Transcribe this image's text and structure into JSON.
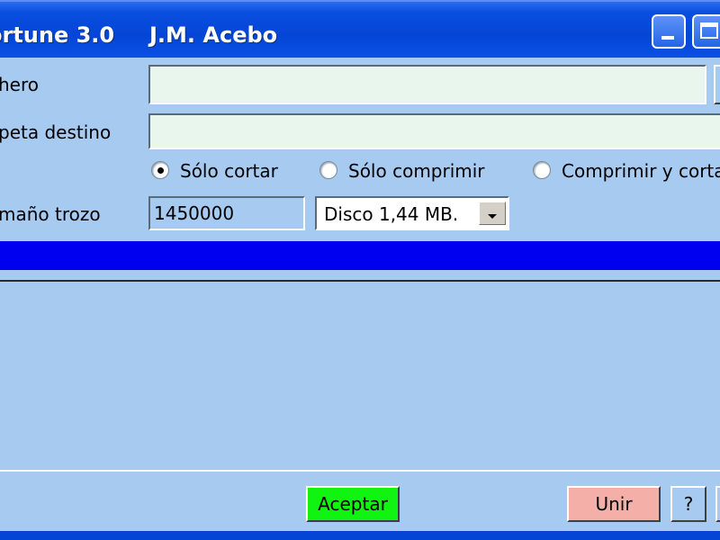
{
  "window": {
    "title": "ortune 3.0",
    "author": "J.M. Acebo"
  },
  "form": {
    "fichero_label": "hero",
    "fichero_value": "",
    "carpeta_label": "peta destino",
    "carpeta_value": "",
    "mode_options": [
      {
        "label": "Sólo cortar",
        "selected": true
      },
      {
        "label": "Sólo comprimir",
        "selected": false
      },
      {
        "label": "Comprimir y cortar",
        "selected": false
      }
    ],
    "tamano_label": "maño trozo",
    "tamano_value": "1450000",
    "disk_select_value": "Disco 1,44 MB."
  },
  "progress": {
    "fraction": 1.0,
    "color": "#0000f0"
  },
  "buttons": {
    "aceptar": "Aceptar",
    "unir": "Unir",
    "help": "?"
  },
  "colors": {
    "background": "#a6caf0",
    "titlebar": "#0445d6",
    "aceptar": "#11f411",
    "unir": "#f4b0a8"
  }
}
